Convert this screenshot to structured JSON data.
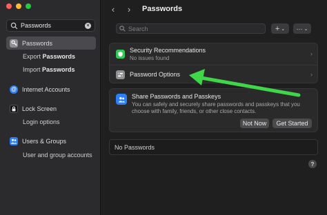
{
  "window": {
    "title": "Passwords"
  },
  "sidebar": {
    "search_value": "Passwords",
    "items": [
      {
        "label": "Passwords",
        "icon": "key-icon",
        "color": "#8e8e93"
      },
      {
        "label": "Internet Accounts",
        "icon": "at-icon",
        "color": "#2d7ff9"
      },
      {
        "label": "Lock Screen",
        "icon": "lock-screen-icon",
        "color": "#1c1c1e"
      },
      {
        "label": "Users & Groups",
        "icon": "users-icon",
        "color": "#2d7ff9"
      }
    ],
    "subitems": {
      "export_prefix": "Export ",
      "export_bold": "Passwords",
      "import_prefix": "Import ",
      "import_bold": "Passwords",
      "login_options": "Login options",
      "user_group_accounts": "User and group accounts"
    }
  },
  "main": {
    "search_placeholder": "Search",
    "add_label": "+",
    "more_label": "···",
    "security": {
      "title": "Security Recommendations",
      "subtitle": "No issues found",
      "color": "#34c759"
    },
    "options": {
      "title": "Password Options"
    },
    "share": {
      "title": "Share Passwords and Passkeys",
      "description": "You can safely and securely share passwords and passkeys that you choose with family, friends, or other close contacts.",
      "not_now": "Not Now",
      "get_started": "Get Started"
    },
    "empty_state": "No Passwords",
    "help": "?"
  },
  "annotation": {
    "arrow_color": "#3fd64a"
  }
}
